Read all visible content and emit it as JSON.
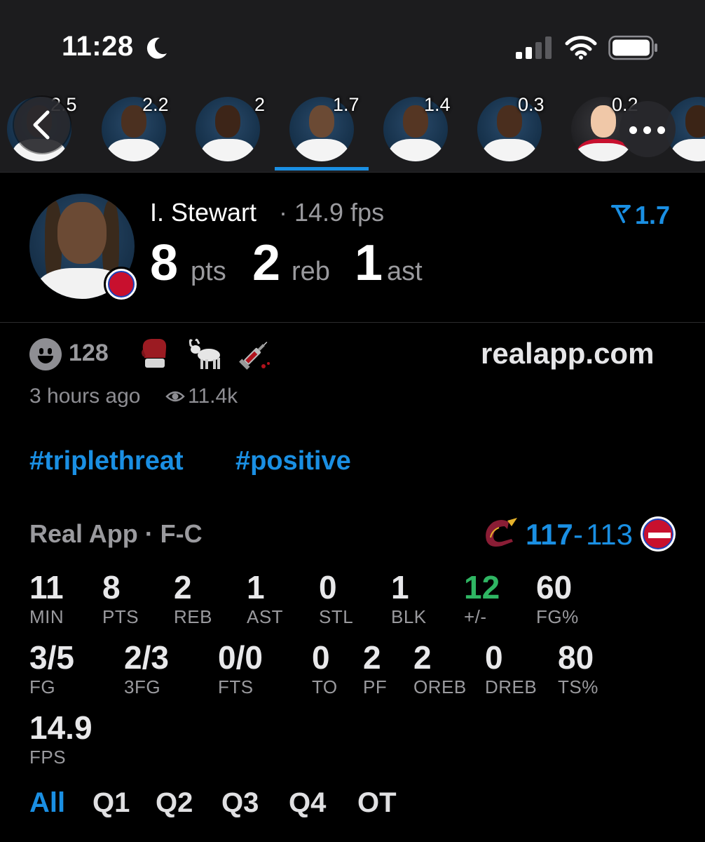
{
  "status": {
    "time": "11:28"
  },
  "strip": {
    "values": [
      "2.5",
      "2.2",
      "2",
      "1.7",
      "1.4",
      "0.3",
      "0.2"
    ]
  },
  "player": {
    "name": "I. Stewart",
    "fps": "· 14.9 fps",
    "trend": "1.7",
    "pts": "8",
    "pts_unit": "pts",
    "reb": "2",
    "reb_unit": "reb",
    "ast": "1",
    "ast_unit": "ast"
  },
  "post": {
    "reaction_count": "128",
    "site": "realapp.com",
    "time_ago": "3 hours ago",
    "views": "11.4k",
    "hashtags": [
      "#triplethreat",
      "#positive"
    ]
  },
  "game": {
    "source": "Real App · F-C",
    "home_score": "117",
    "sep": "-",
    "away_score": "113"
  },
  "stats": [
    {
      "label": "MIN",
      "value": "11"
    },
    {
      "label": "PTS",
      "value": "8"
    },
    {
      "label": "REB",
      "value": "2"
    },
    {
      "label": "AST",
      "value": "1"
    },
    {
      "label": "STL",
      "value": "0"
    },
    {
      "label": "BLK",
      "value": "1"
    },
    {
      "label": "+/-",
      "value": "12"
    },
    {
      "label": "FG%",
      "value": "60"
    },
    {
      "label": "FG",
      "value": "3/5"
    },
    {
      "label": "3FG",
      "value": "2/3"
    },
    {
      "label": "FTS",
      "value": "0/0"
    },
    {
      "label": "TO",
      "value": "0"
    },
    {
      "label": "PF",
      "value": "2"
    },
    {
      "label": "OREB",
      "value": "2"
    },
    {
      "label": "DREB",
      "value": "0"
    },
    {
      "label": "TS%",
      "value": "80"
    },
    {
      "label": "FPS",
      "value": "14.9"
    }
  ],
  "tabs": [
    "All",
    "Q1",
    "Q2",
    "Q3",
    "Q4",
    "OT"
  ],
  "colors": {
    "accent": "#1a8fe3",
    "positive": "#2fb663",
    "background": "#000000",
    "header": "#1c1c1e"
  }
}
